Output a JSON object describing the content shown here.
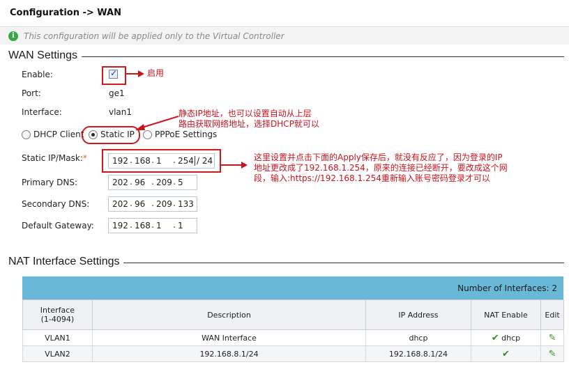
{
  "header": {
    "title": "Configuration -> WAN"
  },
  "notice": {
    "text": "This configuration will be applied only to the Virtual Controller"
  },
  "wan": {
    "section_title": "WAN Settings",
    "enable_label": "Enable:",
    "enable_checked": true,
    "port_label": "Port:",
    "port_value": "ge1",
    "interface_label": "Interface:",
    "interface_value": "vlan1",
    "modes": [
      {
        "label": "DHCP Client",
        "selected": false
      },
      {
        "label": "Static IP",
        "selected": true
      },
      {
        "label": "PPPoE Settings",
        "selected": false
      }
    ],
    "static_ip_label": "Static IP/Mask:",
    "required_mark": "*",
    "static_ip": [
      "192",
      "168",
      "1",
      "254"
    ],
    "mask": "/ 24",
    "primary_dns_label": "Primary DNS:",
    "primary_dns": [
      "202",
      "96",
      "209",
      "5"
    ],
    "secondary_dns_label": "Secondary DNS:",
    "secondary_dns": [
      "202",
      "96",
      "209",
      "133"
    ],
    "gateway_label": "Default Gateway:",
    "gateway": [
      "192",
      "168",
      "1",
      "1"
    ]
  },
  "annotations": {
    "enable": "启用",
    "static_line1": "静态IP地址，也可以设置自动从上层",
    "static_line2": "路由获取网络地址，选择DHCP就可以",
    "apply_line1": "这里设置并点击下面的Apply保存后，就没有反应了，因为登录的IP",
    "apply_line2": "地址更改成了192.168.1.254，原来的连接已经断开，要改成这个网",
    "apply_line3": "段，输入:https://192.168.1.254重新输入账号密码登录才可以"
  },
  "nat": {
    "section_title": "NAT Interface Settings",
    "count_label": "Number of Interfaces:",
    "count": "2",
    "columns": {
      "interface": "Interface",
      "interface_range": "(1-4094)",
      "description": "Description",
      "ip_address": "IP Address",
      "nat_enable": "NAT Enable",
      "edit": "Edit"
    },
    "rows": [
      {
        "interface": "VLAN1",
        "description": "WAN Interface",
        "ip_address": "dhcp",
        "nat_text": "dhcp",
        "nat_enabled": true
      },
      {
        "interface": "VLAN2",
        "description": "192.168.8.1/24",
        "ip_address": "192.168.8.1/24",
        "nat_text": "",
        "nat_enabled": true
      }
    ]
  },
  "colors": {
    "accent_red": "#c8141e",
    "table_header": "#6ab8d8",
    "notice_icon": "#3aa648"
  }
}
